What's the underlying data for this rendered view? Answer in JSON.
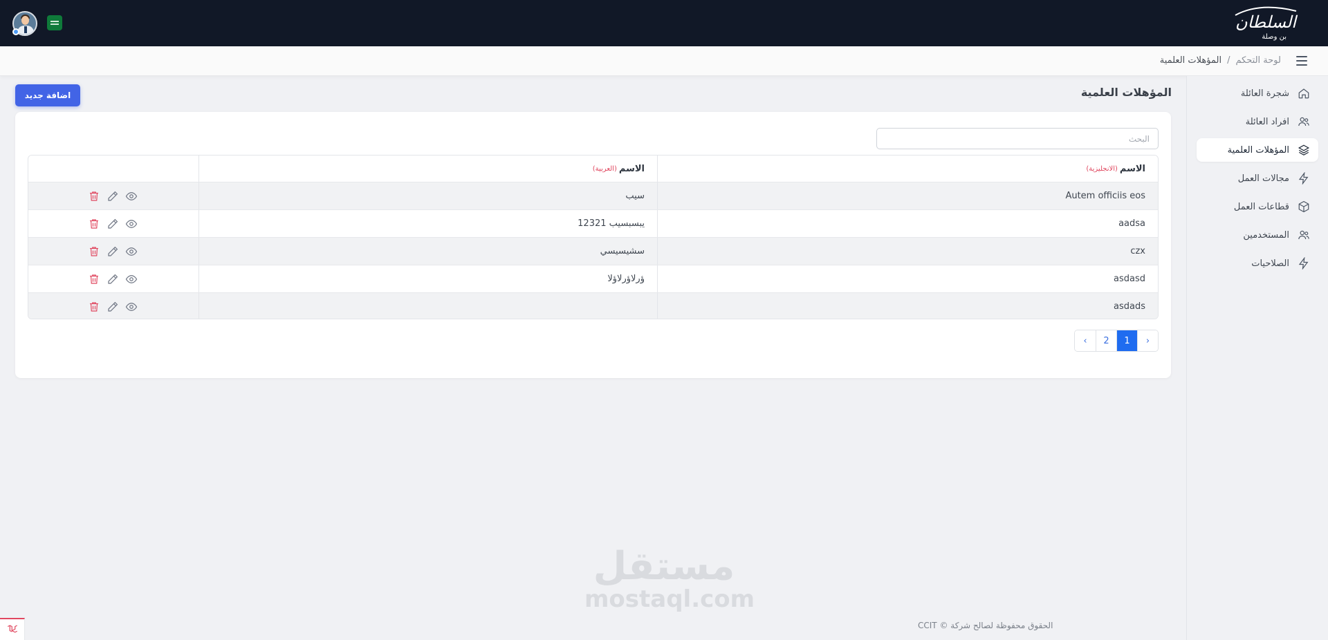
{
  "brand": {
    "logo_text": "السلطان",
    "logo_subtext": "بن وصلة"
  },
  "topbar": {
    "avatar_icon": "user-avatar",
    "language_flag_icon": "saudi-flag-icon"
  },
  "header": {
    "breadcrumb": {
      "home": "لوحة التحكم",
      "separator": "/",
      "current": "المؤهلات العلمية"
    }
  },
  "sidebar": {
    "items": [
      {
        "label": "شجرة العائلة",
        "icon": "home-icon",
        "active": false
      },
      {
        "label": "افراد العائلة",
        "icon": "users-icon",
        "active": false
      },
      {
        "label": "المؤهلات العلمية",
        "icon": "layers-icon",
        "active": true
      },
      {
        "label": "مجالات العمل",
        "icon": "lightning-icon",
        "active": false
      },
      {
        "label": "قطاعات العمل",
        "icon": "box-icon",
        "active": false
      },
      {
        "label": "المستخدمين",
        "icon": "users-icon",
        "active": false
      },
      {
        "label": "الصلاحيات",
        "icon": "lightning-icon",
        "active": false
      }
    ]
  },
  "main": {
    "title": "المؤهلات العلمية",
    "add_button": "اضافة جديد",
    "search_placeholder": "البحث",
    "table": {
      "columns": [
        {
          "label": "الاسم",
          "note": "(الانجليزية)"
        },
        {
          "label": "الاسم",
          "note": "(العربية)"
        },
        {
          "label": ""
        }
      ],
      "rows": [
        {
          "name_en": "Autem officiis eos",
          "name_ar": "سيب"
        },
        {
          "name_en": "aadsa",
          "name_ar": "يبسبسيب 12321"
        },
        {
          "name_en": "czx",
          "name_ar": "سشيسيسي"
        },
        {
          "name_en": "asdasd",
          "name_ar": "ؤرلاؤرلاؤلا"
        },
        {
          "name_en": "asdads",
          "name_ar": ""
        }
      ],
      "row_actions": [
        "view-icon",
        "edit-icon",
        "delete-icon"
      ]
    },
    "pagination": {
      "prev": "‹",
      "pages": [
        "1",
        "2"
      ],
      "current": "1",
      "next": "›"
    }
  },
  "footer": {
    "copyright": "الحقوق محفوظة لصالح شركة © CCIT",
    "watermark_ar": "مستقل",
    "watermark_en": "mostaql.com"
  },
  "colors": {
    "topbar_bg": "#111827",
    "primary_button": "#4264e6",
    "pagination_active": "#1f6cf0",
    "delete_icon": "#e0475f",
    "column_note": "#e0475f"
  }
}
